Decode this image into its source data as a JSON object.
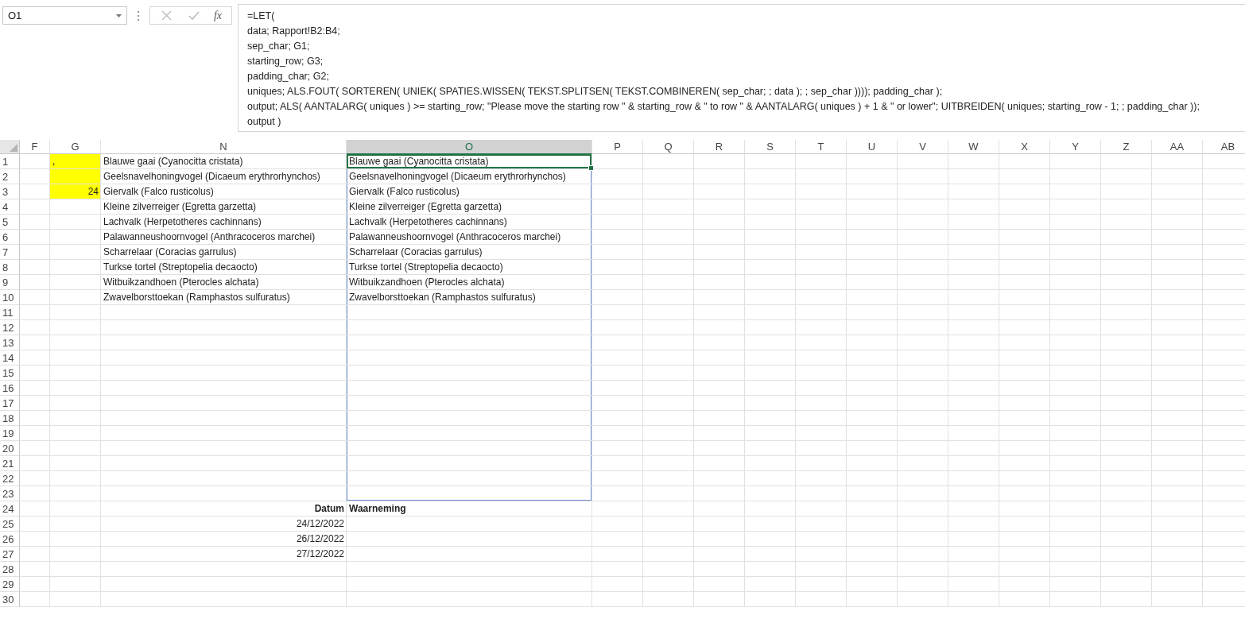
{
  "name_box": {
    "value": "O1"
  },
  "formula_bar": {
    "fx": "fx",
    "lines": [
      "=LET(",
      "data; Rapport!B2:B4;",
      "sep_char; G1;",
      "starting_row; G3;",
      "padding_char; G2;",
      "uniques; ALS.FOUT( SORTEREN( UNIEK( SPATIES.WISSEN( TEKST.SPLITSEN( TEKST.COMBINEREN( sep_char; ; data ); ; sep_char )))); padding_char );",
      "output; ALS( AANTALARG( uniques ) >= starting_row; \"Please move the starting row \" & starting_row & \" to row \" & AANTALARG( uniques ) + 1 & \" or lower\"; UITBREIDEN( uniques; starting_row - 1; ; padding_char ));",
      "output )"
    ]
  },
  "columns": [
    {
      "label": "F",
      "selected": false
    },
    {
      "label": "G",
      "selected": false
    },
    {
      "label": "N",
      "selected": false
    },
    {
      "label": "O",
      "selected": true
    },
    {
      "label": "P",
      "selected": false
    },
    {
      "label": "Q",
      "selected": false
    },
    {
      "label": "R",
      "selected": false
    },
    {
      "label": "S",
      "selected": false
    },
    {
      "label": "T",
      "selected": false
    },
    {
      "label": "U",
      "selected": false
    },
    {
      "label": "V",
      "selected": false
    },
    {
      "label": "W",
      "selected": false
    },
    {
      "label": "X",
      "selected": false
    },
    {
      "label": "Y",
      "selected": false
    },
    {
      "label": "Z",
      "selected": false
    },
    {
      "label": "AA",
      "selected": false
    },
    {
      "label": "AB",
      "selected": false
    }
  ],
  "rows": [
    {
      "number": "1",
      "G": {
        "text": ",",
        "kind": "text",
        "highlighted": true
      },
      "N": {
        "text": "Blauwe gaai (Cyanocitta cristata)",
        "kind": "text"
      },
      "O": {
        "text": "Blauwe gaai (Cyanocitta cristata)",
        "kind": "text",
        "active": true,
        "spilled": true
      }
    },
    {
      "number": "2",
      "G": {
        "kind": "text",
        "highlighted": true
      },
      "N": {
        "text": "Geelsnavelhoningvogel (Dicaeum erythrorhynchos)",
        "kind": "text"
      },
      "O": {
        "text": "Geelsnavelhoningvogel (Dicaeum erythrorhynchos)",
        "kind": "text",
        "spilled": true
      }
    },
    {
      "number": "3",
      "G": {
        "text": "24",
        "kind": "number",
        "highlighted": true
      },
      "N": {
        "text": "Giervalk (Falco rusticolus)",
        "kind": "text"
      },
      "O": {
        "text": "Giervalk (Falco rusticolus)",
        "kind": "text",
        "spilled": true
      }
    },
    {
      "number": "4",
      "N": {
        "text": "Kleine zilverreiger (Egretta garzetta)",
        "kind": "text"
      },
      "O": {
        "text": "Kleine zilverreiger (Egretta garzetta)",
        "kind": "text",
        "spilled": true
      }
    },
    {
      "number": "5",
      "N": {
        "text": "Lachvalk (Herpetotheres cachinnans)",
        "kind": "text"
      },
      "O": {
        "text": "Lachvalk (Herpetotheres cachinnans)",
        "kind": "text",
        "spilled": true
      }
    },
    {
      "number": "6",
      "N": {
        "text": "Palawanneushoornvogel (Anthracoceros marchei)",
        "kind": "text"
      },
      "O": {
        "text": "Palawanneushoornvogel (Anthracoceros marchei)",
        "kind": "text",
        "spilled": true
      }
    },
    {
      "number": "7",
      "N": {
        "text": "Scharrelaar (Coracias garrulus)",
        "kind": "text"
      },
      "O": {
        "text": "Scharrelaar (Coracias garrulus)",
        "kind": "text",
        "spilled": true
      }
    },
    {
      "number": "8",
      "N": {
        "text": "Turkse tortel (Streptopelia decaocto)",
        "kind": "text"
      },
      "O": {
        "text": "Turkse tortel (Streptopelia decaocto)",
        "kind": "text",
        "spilled": true
      }
    },
    {
      "number": "9",
      "N": {
        "text": "Witbuikzandhoen (Pterocles alchata)",
        "kind": "text"
      },
      "O": {
        "text": "Witbuikzandhoen (Pterocles alchata)",
        "kind": "text",
        "spilled": true
      }
    },
    {
      "number": "10",
      "N": {
        "text": "Zwavelborsttoekan (Ramphastos sulfuratus)",
        "kind": "text"
      },
      "O": {
        "text": "Zwavelborsttoekan (Ramphastos sulfuratus)",
        "kind": "text",
        "spilled": true
      }
    },
    {
      "number": "11",
      "O": {
        "spilled": true
      }
    },
    {
      "number": "12",
      "O": {
        "spilled": true
      }
    },
    {
      "number": "13",
      "O": {
        "spilled": true
      }
    },
    {
      "number": "14",
      "O": {
        "spilled": true
      }
    },
    {
      "number": "15",
      "O": {
        "spilled": true
      }
    },
    {
      "number": "16",
      "O": {
        "spilled": true
      }
    },
    {
      "number": "17",
      "O": {
        "spilled": true
      }
    },
    {
      "number": "18",
      "O": {
        "spilled": true
      }
    },
    {
      "number": "19",
      "O": {
        "spilled": true
      }
    },
    {
      "number": "20",
      "O": {
        "spilled": true
      }
    },
    {
      "number": "21",
      "O": {
        "spilled": true
      }
    },
    {
      "number": "22",
      "O": {
        "spilled": true
      }
    },
    {
      "number": "23",
      "O": {
        "spilled": true
      }
    },
    {
      "number": "24",
      "N": {
        "text": "Datum",
        "kind": "heading-right"
      },
      "O": {
        "text": "Waarneming",
        "kind": "heading"
      }
    },
    {
      "number": "25",
      "N": {
        "text": "24/12/2022",
        "kind": "number"
      }
    },
    {
      "number": "26",
      "N": {
        "text": "26/12/2022",
        "kind": "number"
      }
    },
    {
      "number": "27",
      "N": {
        "text": "27/12/2022",
        "kind": "number"
      }
    },
    {
      "number": "28"
    },
    {
      "number": "29"
    },
    {
      "number": "30"
    }
  ]
}
